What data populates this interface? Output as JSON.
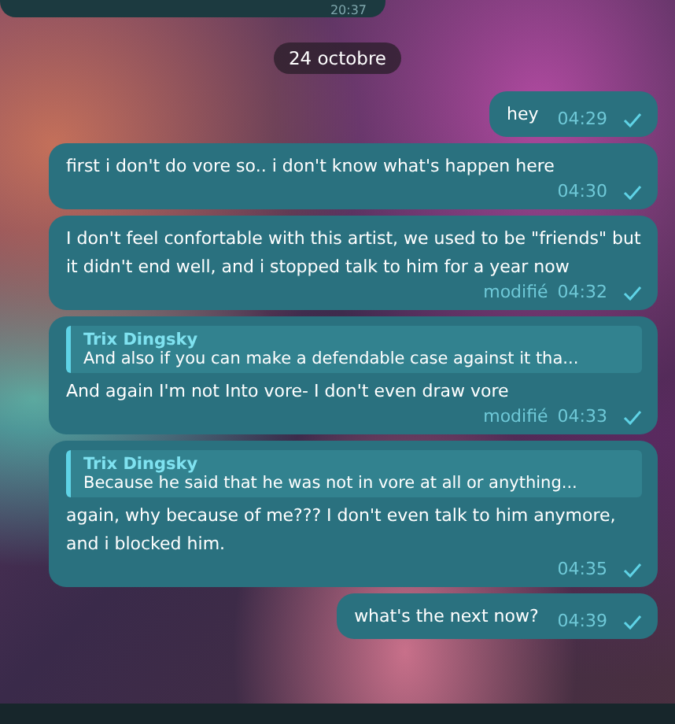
{
  "previous_message": {
    "time": "20:37"
  },
  "date_badge": "24 octobre",
  "messages": [
    {
      "text": "hey",
      "time": "04:29"
    },
    {
      "text": "first i don't do vore so.. i don't know what's happen here",
      "time": "04:30"
    },
    {
      "text": "I don't feel confortable with this artist, we used to be \"friends\" but it didn't end well, and i stopped talk to him for a year now",
      "edited": "modifié",
      "time": "04:32"
    },
    {
      "reply": {
        "author": "Trix Dingsky",
        "text": "And also if you can make a defendable case against it tha..."
      },
      "text": "And again I'm not Into vore- I don't even draw vore",
      "edited": "modifié",
      "time": "04:33"
    },
    {
      "reply": {
        "author": "Trix Dingsky",
        "text": "Because he said that he was not in vore at all or anything..."
      },
      "text": "again, why because of me??? I don't even talk to him anymore, and i blocked him.",
      "time": "04:35"
    },
    {
      "text": "what's the next now?",
      "time": "04:39"
    }
  ]
}
